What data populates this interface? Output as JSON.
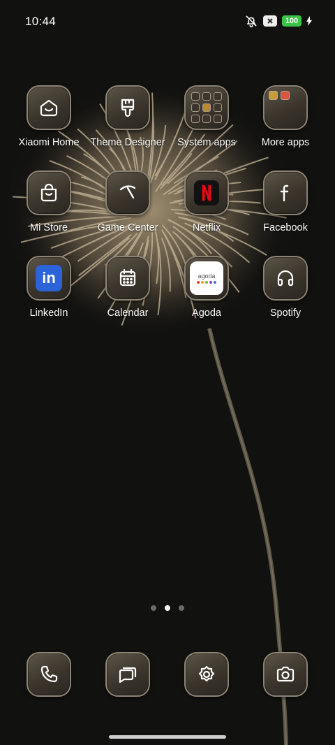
{
  "status_bar": {
    "time": "10:44",
    "battery": "100",
    "icons": [
      "mute-icon",
      "close-badge-icon",
      "battery-icon",
      "charging-bolt-icon"
    ]
  },
  "apps": [
    {
      "label": "Xiaomi Home",
      "icon": "xiaomi-home-icon"
    },
    {
      "label": "Theme Designer",
      "icon": "paintbrush-icon"
    },
    {
      "label": "System apps",
      "icon": "folder-icon"
    },
    {
      "label": "More apps",
      "icon": "folder-icon"
    },
    {
      "label": "Mi Store",
      "icon": "shopping-bag-icon"
    },
    {
      "label": "Game Center",
      "icon": "game-center-icon"
    },
    {
      "label": "Netflix",
      "icon": "netflix-icon"
    },
    {
      "label": "Facebook",
      "icon": "facebook-icon"
    },
    {
      "label": "LinkedIn",
      "icon": "linkedin-icon"
    },
    {
      "label": "Calendar",
      "icon": "calendar-icon"
    },
    {
      "label": "Agoda",
      "icon": "agoda-icon"
    },
    {
      "label": "Spotify",
      "icon": "headphones-icon"
    }
  ],
  "agoda_logo_text": "agoda",
  "linkedin_logo_text": "in",
  "pages": {
    "count": 3,
    "active": 2
  },
  "dock": [
    {
      "icon": "phone-icon"
    },
    {
      "icon": "messages-icon"
    },
    {
      "icon": "settings-icon"
    },
    {
      "icon": "camera-icon"
    }
  ],
  "colors": {
    "battery": "#38c545",
    "icon_tile": "#3b352c",
    "netflix_red": "#e50914",
    "linkedin_blue": "#2b63d9"
  }
}
